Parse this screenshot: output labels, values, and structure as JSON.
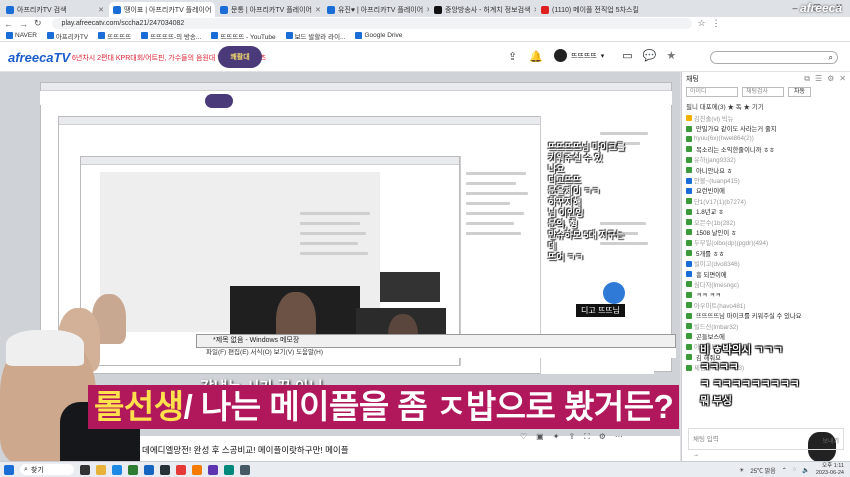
{
  "browser": {
    "tabs": [
      {
        "label": "아프리카TV 검색",
        "color": "#1a6dd6",
        "active": false
      },
      {
        "label": "땡이표 | 아프리카TV 플레이어",
        "color": "#1a6dd6",
        "active": true
      },
      {
        "label": "문통 | 아프리카TV 플레이어",
        "color": "#1a6dd6",
        "active": false
      },
      {
        "label": "유진♥ | 아프리카TV 플레이어",
        "color": "#1a6dd6",
        "active": false
      },
      {
        "label": "중앙방송사 - 허계치 정보검색",
        "color": "#111111",
        "active": false
      },
      {
        "label": "(1110) 메이플 전직업 5차스킬",
        "color": "#e02020",
        "active": false
      }
    ],
    "url": "play.afreecatv.com/sccha21/247034082",
    "bookmarks": [
      "NAVER",
      "아프리카TV",
      "뜨뜨뜨뜨",
      "뜨뜨뜨뜨-의 방송...",
      "뜨뜨뜨뜨 - YouTube",
      "보드 발할라 라이...",
      "Google Drive"
    ]
  },
  "afreeca": {
    "logo": "afreecaTV",
    "promo": "6년차시 2편대 KPR대회/어트핀, 가수들의 음원대 방송 메인 콘텐츠",
    "badge": "쾌활대",
    "username": "뜨뜨뜨뜨",
    "search_icon": "search-icon"
  },
  "stream": {
    "subtitle_highlight": "롤선생",
    "subtitle_rest": "/ 나는 메이플을 좀 ㅈ밥으로 봤거든?",
    "small_title": "같냈는 시가 끝 아니",
    "caption": "데에디엘망전! 완성 후 스공비교! 메이플이랏하구만! 메이플",
    "dialog_title": "*제목 없음 - Windows 메모장",
    "dialog_menu": "파일(F)  편집(E)  서식(O)  보기(V)  도움말(H)",
    "overlay_chat": [
      "뜨뜨뜨뜨님 마이크를 키워주실 수 있",
      "나요",
      "디고뜨뜨",
      "문을제이 ㅋㅋ",
      "하꾸지해",
      "님 이인잉",
      "문의, 형",
      "만슈하모 5대 지구는데",
      "뜨어 ㅋㅋ"
    ],
    "ddigo": "디고 뜨뜨님"
  },
  "chat": {
    "title": "채팅",
    "filter_placeholder": "아이디",
    "filter_select": "채팅검사",
    "filter_button": "차동",
    "notice": "필니 대포에(3)  ★ 독 ★ 기기",
    "messages": [
      {
        "user": "김진솔(vl) 빅뉴",
        "text": "",
        "color": "#f0b000"
      },
      {
        "user": "",
        "text": "만밀가요 같이도 사라는거 줄지",
        "color": "#3b9b3b"
      },
      {
        "user": "hyuu(6x)(hwel864(2))",
        "text": "",
        "color": "#3b9b3b"
      },
      {
        "user": "",
        "text": "목소리는 소익한줄이니까 ㅎㅎ",
        "color": "#3b9b3b"
      },
      {
        "user": "유하(jang9332)",
        "text": "",
        "color": "#3b9b3b"
      },
      {
        "user": "",
        "text": "아니안나요 ㅎ",
        "color": "#3b9b3b"
      },
      {
        "user": "안볼~(tuanp415)",
        "text": "",
        "color": "#1a6dd6"
      },
      {
        "user": "",
        "text": "요런빈이에",
        "color": "#1a6dd6"
      },
      {
        "user": "단1(V17(1)(b7274)",
        "text": "",
        "color": "#3b9b3b"
      },
      {
        "user": "",
        "text": "1.8년교 ㅎ",
        "color": "#3b9b3b"
      },
      {
        "user": "오믄수(1b(282)",
        "text": "",
        "color": "#3b9b3b"
      },
      {
        "user": "",
        "text": "1508 날인이 ㅎ",
        "color": "#3b9b3b"
      },
      {
        "user": "두부일(olbo(dp)(pgdr)(494)",
        "text": "",
        "color": "#3b9b3b"
      },
      {
        "user": "",
        "text": "5개를 ㅎㅎ",
        "color": "#3b9b3b"
      },
      {
        "user": "빌이고(dvo8346)",
        "text": "",
        "color": "#1a6dd6"
      },
      {
        "user": "",
        "text": "흥 되면이에",
        "color": "#1a6dd6"
      },
      {
        "user": "심다자(lmesngc)",
        "text": "",
        "color": "#3b9b3b"
      },
      {
        "user": "",
        "text": "ㅋㅋ ㅋㅋ",
        "color": "#3b9b3b"
      },
      {
        "user": "아우미트(havo481)",
        "text": "",
        "color": "#3b9b3b"
      },
      {
        "user": "",
        "text": "뜨뜨뜨뜨님 마이크를 키워주실 수 있나요",
        "color": "#3b9b3b"
      },
      {
        "user": "빌드산(lmbar32)",
        "text": "",
        "color": "#3b9b3b"
      },
      {
        "user": "",
        "text": "곤들보스에",
        "color": "#3b9b3b"
      },
      {
        "user": "아우미트(havo481)",
        "text": "",
        "color": "#3b9b3b"
      },
      {
        "user": "",
        "text": "김 해줘요",
        "color": "#3b9b3b"
      },
      {
        "user": "제임나드(dadt923)",
        "text": "",
        "color": "#3b9b3b"
      }
    ],
    "big_overlay": [
      "비 ㅎ박의시 ㄱㄱㄱ",
      "ㅋㅋㅋㅋ",
      "ㅋ ㅋㅋㅋㅋㅋㅋㅋㅋㅋ",
      "뭐 부싱"
    ],
    "input_placeholder": "채팅 입력",
    "send_label": "보내기",
    "arrow": "→"
  },
  "taskbar": {
    "search": "찾기",
    "weather": "25℃ 맑음",
    "time": "오후 1:11",
    "date": "2023-06-24",
    "watermark": "afreeca"
  }
}
